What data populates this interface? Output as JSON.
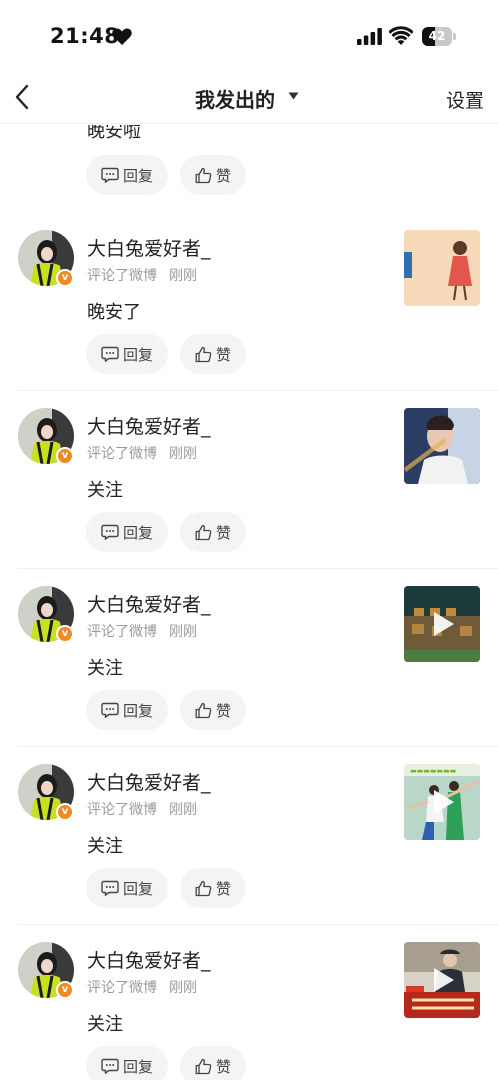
{
  "status_bar": {
    "time": "21:48",
    "battery": "42",
    "battery_level": 0.42
  },
  "nav": {
    "title": "我发出的",
    "settings": "设置"
  },
  "actions": {
    "reply": "回复",
    "like": "赞"
  },
  "partial_item": {
    "text": "晚安啦"
  },
  "items": [
    {
      "username": "大白兔爱好者_",
      "action": "评论了微博",
      "time": "刚刚",
      "text": "晚安了",
      "thumb": "illustration",
      "video": false
    },
    {
      "username": "大白兔爱好者_",
      "action": "评论了微博",
      "time": "刚刚",
      "text": "关注",
      "thumb": "portrait",
      "video": false
    },
    {
      "username": "大白兔爱好者_",
      "action": "评论了微博",
      "time": "刚刚",
      "text": "关注",
      "thumb": "exhibit",
      "video": true
    },
    {
      "username": "大白兔爱好者_",
      "action": "评论了微博",
      "time": "刚刚",
      "text": "关注",
      "thumb": "dancers",
      "video": true
    },
    {
      "username": "大白兔爱好者_",
      "action": "评论了微博",
      "time": "刚刚",
      "text": "关注",
      "thumb": "news",
      "video": true
    }
  ],
  "colors": {
    "badge": "#f08a24",
    "button_bg": "#f4f4f4",
    "meta_text": "#9a9a9a"
  }
}
